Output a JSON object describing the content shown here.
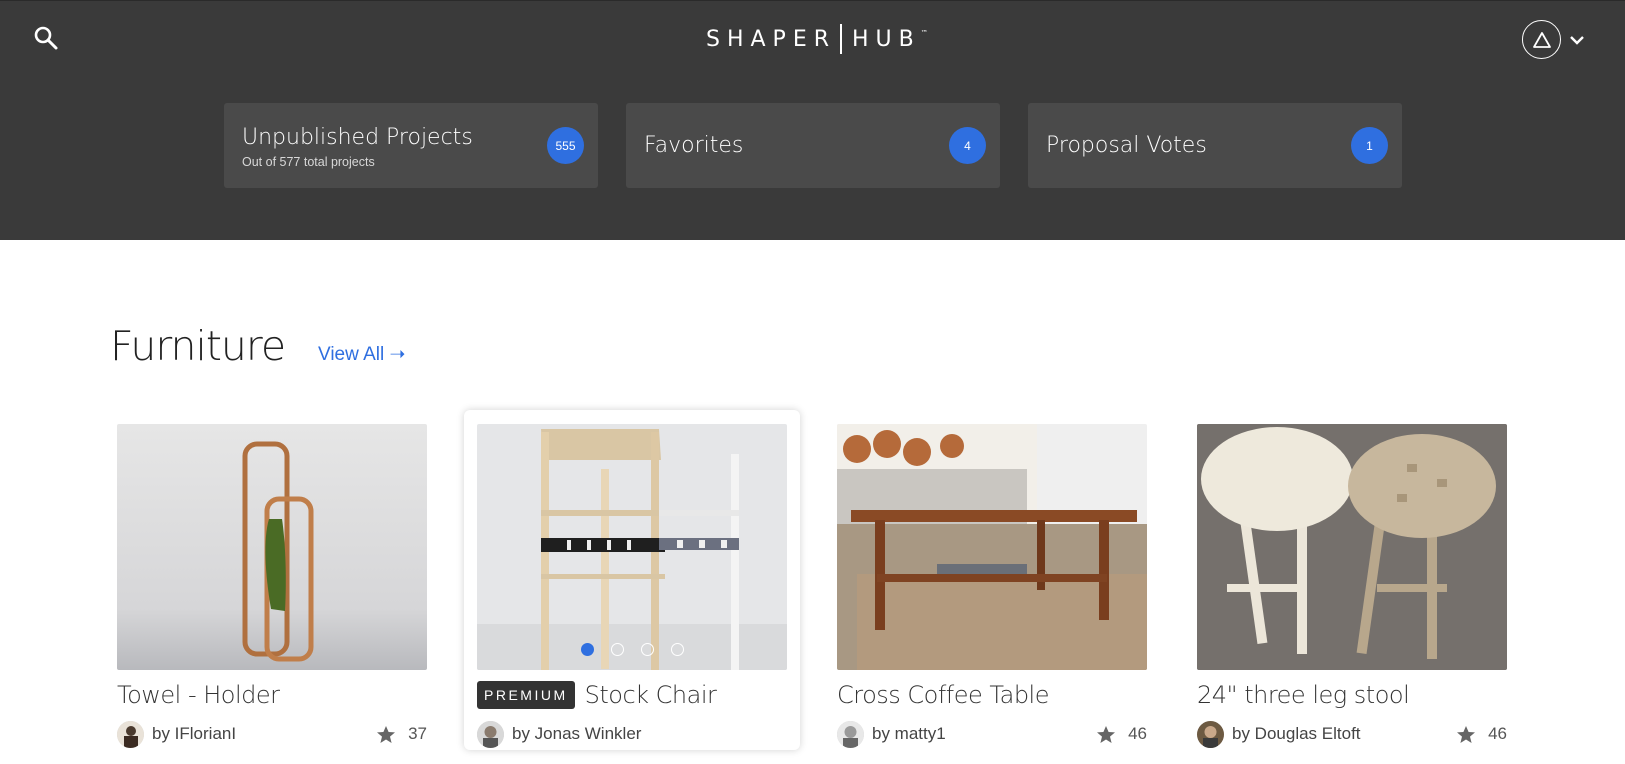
{
  "header": {
    "logo_left": "SHAPER",
    "logo_right": "HUB",
    "logo_tm": "™",
    "search_icon": "search-icon",
    "account_icon": "triangle-avatar-icon",
    "chevron_icon": "chevron-down-icon"
  },
  "stats": [
    {
      "title": "Unpublished Projects",
      "subtitle": "Out of 577 total projects",
      "count": "555"
    },
    {
      "title": "Favorites",
      "subtitle": "",
      "count": "4"
    },
    {
      "title": "Proposal Votes",
      "subtitle": "",
      "count": "1"
    }
  ],
  "section": {
    "title": "Furniture",
    "view_all": "View All ➝"
  },
  "projects": [
    {
      "title": "Towel - Holder",
      "author": "by IFlorianI",
      "stars": "37",
      "premium": ""
    },
    {
      "title": "Stock Chair",
      "author": "by Jonas Winkler",
      "stars": "",
      "premium": "PREMIUM",
      "carousel_active": 1,
      "carousel_count": 4
    },
    {
      "title": "Cross Coffee Table",
      "author": "by matty1",
      "stars": "46",
      "premium": ""
    },
    {
      "title": "24\" three leg stool",
      "author": "by Douglas Eltoft",
      "stars": "46",
      "premium": ""
    }
  ],
  "colors": {
    "header_bg": "#3a3a3a",
    "card_bg": "#4a4a4a",
    "accent": "#2f6fe0"
  }
}
